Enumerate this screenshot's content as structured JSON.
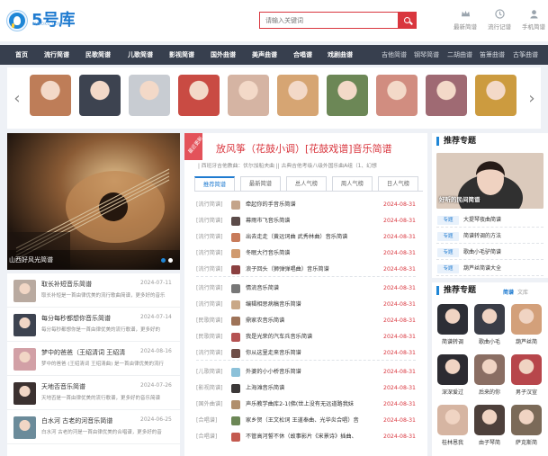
{
  "site": {
    "name": "5号库",
    "domain_tag": "SHAOKU.COM"
  },
  "search": {
    "placeholder": "请输入关键词"
  },
  "tools": [
    {
      "label": "最新简谱",
      "icon": "crown-icon"
    },
    {
      "label": "流行记谱",
      "icon": "clock-icon"
    },
    {
      "label": "手机简谱",
      "icon": "user-icon"
    }
  ],
  "nav": {
    "main": [
      "首页",
      "流行简谱",
      "民歌简谱",
      "儿歌简谱",
      "影视简谱",
      "国外曲谱",
      "美声曲谱",
      "合唱谱",
      "戏剧曲谱"
    ],
    "extra": [
      "吉他简谱",
      "钢琴简谱",
      "二胡曲谱",
      "笛箫曲谱",
      "古筝曲谱"
    ]
  },
  "artists": {
    "colors": [
      "#be7d58",
      "#3d4350",
      "#c8ccd2",
      "#c94b43",
      "#d5b4a3",
      "#d6a573",
      "#6c8756",
      "#d18d80",
      "#9f6a73",
      "#cc9b3f"
    ]
  },
  "slide": {
    "caption": "山西好风光简谱"
  },
  "news": [
    {
      "title": "取长补短音乐简谱",
      "date": "2024-07-11",
      "desc": "取长补短是一首由律优美的流行歌曲简谱，更多好的音乐",
      "color": "#b9aaa0"
    },
    {
      "title": "每分每秒都想你音乐简谱",
      "date": "2024-07-14",
      "desc": "每分每秒都想你是一首由律优美的流行歌谱，更多好的",
      "color": "#3d4350"
    },
    {
      "title": "梦中的爸爸（王绍清词 王绍清",
      "date": "2024-08-16",
      "desc": "梦中的爸爸 (王绍清词 王绍清曲) 是一首由律优美的流行",
      "color": "#d2a0a6"
    },
    {
      "title": "天地否音乐简谱",
      "date": "2024-07-26",
      "desc": "天地否是一首由律优美的流行歌谱，更多好的音乐简谱",
      "color": "#3b3130"
    },
    {
      "title": "白水河 古老的河音乐简谱",
      "date": "2024-06-25",
      "desc": "白水河 古老的河是一首由律优美的合唱谱，更多好的音",
      "color": "#6b8b9a"
    }
  ],
  "center": {
    "ribbon": "最近更新",
    "headline": "放风筝（花鼓小调）[花鼓戏谱]音乐简谱",
    "subline": "| 西班牙吉他教曲：伏尔加船夫曲 || 古典吉他考级八级外国乐曲A组（1、幻想",
    "tabs": [
      "推荐简谱",
      "最新简谱",
      "总人气榜",
      "周人气榜",
      "日人气榜"
    ],
    "groups": [
      [
        {
          "cat": "[流行简谱]",
          "name": "牵起你的手音乐简谱",
          "date": "2024-08-31",
          "color": "#c4a48a"
        },
        {
          "cat": "[流行简谱]",
          "name": "幕雨市飞音乐简谱",
          "date": "2024-08-31",
          "color": "#5b4b49"
        },
        {
          "cat": "[流行简谱]",
          "name": "出去走走（黄远词曲 武秀林曲）音乐简谱",
          "date": "2024-08-31",
          "color": "#c87b5a"
        },
        {
          "cat": "[流行简谱]",
          "name": "冬眠大行音乐简谱",
          "date": "2024-08-31",
          "color": "#d09a6e"
        },
        {
          "cat": "[流行简谱]",
          "name": "浪子回头（狮弹弹唱曲）音乐简谱",
          "date": "2024-08-31",
          "color": "#8b4040"
        }
      ],
      [
        {
          "cat": "[流行简谱]",
          "name": "情流音乐简谱",
          "date": "2024-08-31",
          "color": "#777777"
        },
        {
          "cat": "[流行简谱]",
          "name": "编辑相思病稿音乐简谱",
          "date": "2024-08-31",
          "color": "#c9a887"
        },
        {
          "cat": "[民歌简谱]",
          "name": "鼎家农音乐简谱",
          "date": "2024-08-31",
          "color": "#9e7358"
        },
        {
          "cat": "[民歌简谱]",
          "name": "我是光荣的汽车兵音乐简谱",
          "date": "2024-08-31",
          "color": "#b55252"
        },
        {
          "cat": "[流行简谱]",
          "name": "你从这里走来音乐简谱",
          "date": "2024-08-31",
          "color": "#6f4f48"
        }
      ],
      [
        {
          "cat": "[儿歌简谱]",
          "name": "外婆的小小桥音乐简谱",
          "date": "2024-08-31",
          "color": "#8cc1d9"
        },
        {
          "cat": "[影视简谱]",
          "name": "上海滩音乐简谱",
          "date": "2024-08-31",
          "color": "#3b3838"
        },
        {
          "cat": "[国外曲谱]",
          "name": "声乐教学曲库2-1(佛(世上没有无远道路我妹",
          "date": "2024-08-31",
          "color": "#b08f6d"
        },
        {
          "cat": "[合唱谱]",
          "name": "家乡贺（王文松词 王道奉曲、光华炎合唱）音",
          "date": "2024-08-31",
          "color": "#6c8756"
        },
        {
          "cat": "[合唱谱]",
          "name": "不管高河誓不休（故事影片《宋景诗》插曲、",
          "date": "2024-08-31",
          "color": "#c45a4f"
        }
      ]
    ]
  },
  "featured": {
    "title": "推荐专题",
    "caption": "好听的民间简谱",
    "topics": [
      {
        "tag": "专题",
        "title": "大提琴夜曲简谱"
      },
      {
        "tag": "专题",
        "title": "简谱转调的方法"
      },
      {
        "tag": "专题",
        "title": "歌曲小毛驴简谱"
      },
      {
        "tag": "专题",
        "title": "葫芦丝简谱大全"
      }
    ]
  },
  "singers": {
    "title": "推荐专题",
    "tab_active": "简谱",
    "tab_other": "文库",
    "items": [
      {
        "name": "简谱转调",
        "color": "#2d2f36"
      },
      {
        "name": "歌曲小毛",
        "color": "#3a3d47"
      },
      {
        "name": "葫芦丝简",
        "color": "#d3a07a"
      },
      {
        "name": "深深爱过",
        "color": "#2c2b31"
      },
      {
        "name": "后来的你",
        "color": "#8a6e63"
      },
      {
        "name": "男子汉宣",
        "color": "#b7464b"
      },
      {
        "name": "桂林恩我",
        "color": "#d6b5a2"
      },
      {
        "name": "由子琴简",
        "color": "#4d403b"
      },
      {
        "name": "萨克斯简",
        "color": "#7b6a58"
      }
    ]
  }
}
